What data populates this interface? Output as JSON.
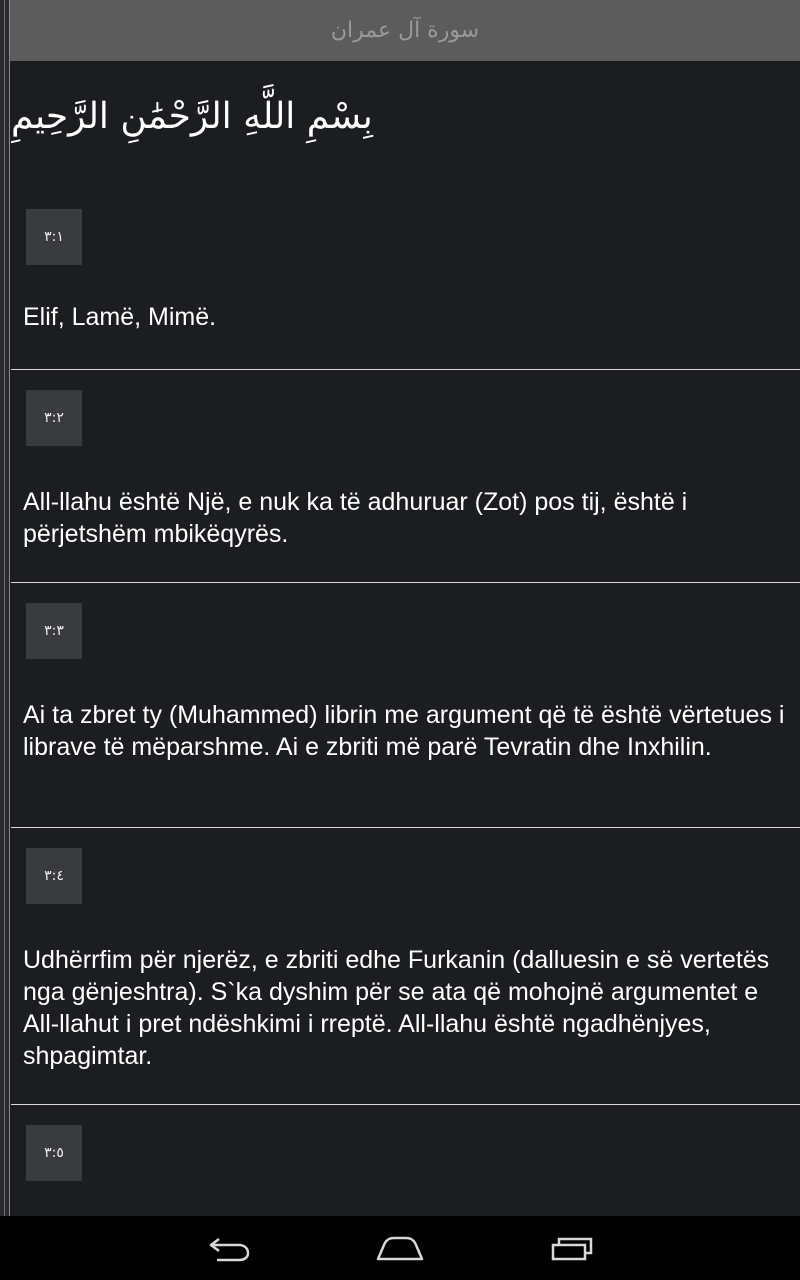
{
  "header": {
    "title": "سورة آل عمران"
  },
  "bismillah": "بِسْمِ اللَّهِ الرَّحْمَٰنِ الرَّحِيمِ",
  "verses": [
    {
      "number": "٣:١",
      "text": "Elif, Lamë, Mimë."
    },
    {
      "number": "٣:٢",
      "text": "All-llahu është Një, e nuk ka të adhuruar (Zot) pos tij, është i përjetshëm mbikëqyrës."
    },
    {
      "number": "٣:٣",
      "text": "Ai ta zbret ty (Muhammed) librin me argument që të është vërtetues i librave të mëparshme. Ai e zbriti më parë Tevratin dhe Inxhilin."
    },
    {
      "number": "٣:٤",
      "text": "Udhërrfim për njerëz, e zbriti edhe Furkanin (dalluesin e së vertetës nga gënjeshtra). S`ka dyshim për se ata që mohojnë argumentet e All-llahut i pret ndëshkimi i rreptë. All-llahu është ngadhënjyes, shpagimtar."
    },
    {
      "number": "٣:٥",
      "text": ""
    }
  ],
  "navigation": {
    "back_icon": "back-icon",
    "home_icon": "home-icon",
    "recents_icon": "recents-icon"
  },
  "colors": {
    "background": "#1c1d20",
    "title_bar": "#5c5c5c",
    "badge": "#3a3b3e",
    "text": "#ffffff",
    "nav_bar": "#000000"
  }
}
